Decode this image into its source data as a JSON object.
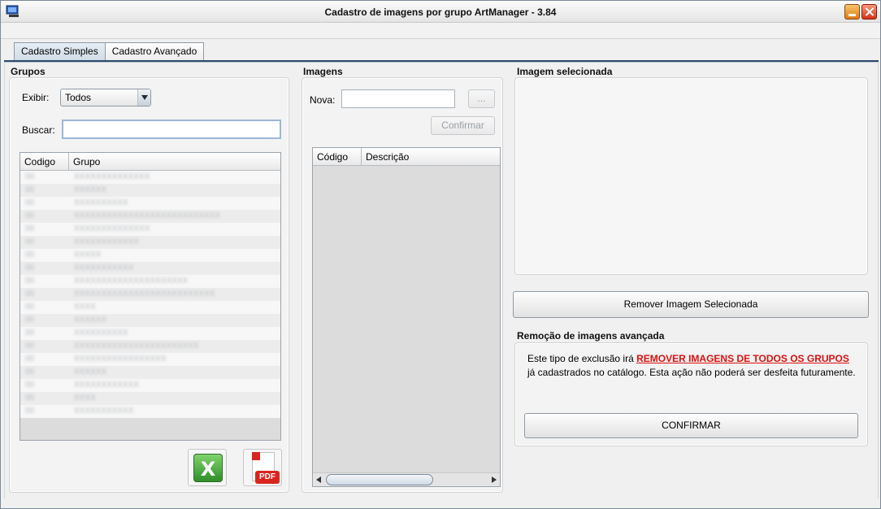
{
  "window": {
    "title": "Cadastro de imagens por grupo ArtManager - 3.84"
  },
  "tabs": [
    {
      "label": "Cadastro Simples",
      "active": true
    },
    {
      "label": "Cadastro Avançado",
      "active": false
    }
  ],
  "grupos": {
    "title": "Grupos",
    "exibir_label": "Exibir:",
    "exibir_value": "Todos",
    "buscar_label": "Buscar:",
    "buscar_value": "",
    "columns": [
      "Codigo",
      "Grupo"
    ],
    "rows": [
      {
        "code": "00",
        "name": "XXXXXXXXXXXXXX"
      },
      {
        "code": "00",
        "name": "XXXXXX"
      },
      {
        "code": "00",
        "name": "XXXXXXXXXX"
      },
      {
        "code": "00",
        "name": "XXXXXXXXXXXXXXXXXXXXXXXXXXX"
      },
      {
        "code": "00",
        "name": "XXXXXXXXXXXXXX"
      },
      {
        "code": "00",
        "name": "XXXXXXXXXXXX"
      },
      {
        "code": "00",
        "name": "XXXXX"
      },
      {
        "code": "00",
        "name": "XXXXXXXXXXX"
      },
      {
        "code": "00",
        "name": "XXXXXXXXXXXXXXXXXXXXX"
      },
      {
        "code": "00",
        "name": "XXXXXXXXXXXXXXXXXXXXXXXXXX"
      },
      {
        "code": "00",
        "name": "XXXX"
      },
      {
        "code": "00",
        "name": "XXXXXX"
      },
      {
        "code": "00",
        "name": "XXXXXXXXXX"
      },
      {
        "code": "00",
        "name": "XXXXXXXXXXXXXXXXXXXXXXX"
      },
      {
        "code": "00",
        "name": "XXXXXXXXXXXXXXXXX"
      },
      {
        "code": "00",
        "name": "XXXXXX"
      },
      {
        "code": "00",
        "name": "XXXXXXXXXXXX"
      },
      {
        "code": "00",
        "name": "XXXX"
      },
      {
        "code": "00",
        "name": "XXXXXXXXXXX"
      }
    ]
  },
  "imagens": {
    "title": "Imagens",
    "nova_label": "Nova:",
    "nova_value": "",
    "browse_label": "...",
    "confirmar_label": "Confirmar",
    "columns": [
      "Código",
      "Descrição"
    ]
  },
  "selecionada": {
    "title": "Imagem selecionada",
    "remove_label": "Remover Imagem Selecionada"
  },
  "remocao": {
    "title": "Remoção de imagens avançada",
    "text_before": "Este tipo de exclusão irá ",
    "text_strong": "REMOVER IMAGENS DE TODOS OS GRUPOS",
    "text_after": " já cadastrados no catálogo. Esta ação não poderá ser desfeita futuramente.",
    "confirm_label": "CONFIRMAR"
  },
  "icons": {
    "excel": "excel-export-icon",
    "pdf": "pdf-export-icon",
    "pdf_badge": "PDF"
  }
}
